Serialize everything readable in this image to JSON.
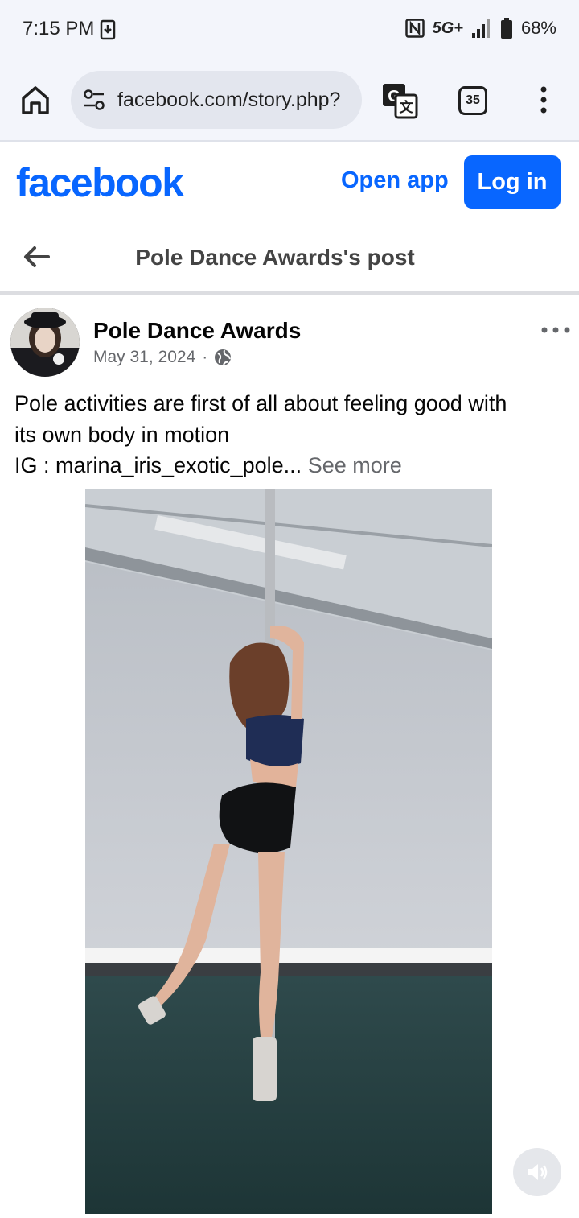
{
  "status_bar": {
    "time": "7:15 PM",
    "network": "5G+",
    "battery": "68%",
    "icons": [
      "download-icon",
      "nfc-icon",
      "signal-icon",
      "battery-icon"
    ]
  },
  "browser": {
    "url": "facebook.com/story.php?",
    "tab_count": "35",
    "icons": [
      "home-icon",
      "site-settings-icon",
      "translate-icon",
      "more-vert-icon"
    ]
  },
  "facebook_header": {
    "logo": "facebook",
    "open_app_label": "Open app",
    "login_label": "Log in"
  },
  "post_bar": {
    "title": "Pole Dance Awards's post"
  },
  "post": {
    "author": "Pole Dance Awards",
    "date": "May 31, 2024",
    "separator": "·",
    "text_line_1": "Pole activities are first of all about feeling good with",
    "text_line_2": "its own body in motion",
    "text_line_3": "IG : marina_iris_exotic_pole...",
    "see_more": "See more"
  },
  "colors": {
    "brand": "#0866ff",
    "secondary_text": "#65676b",
    "browser_chrome": "#f3f5fb"
  }
}
